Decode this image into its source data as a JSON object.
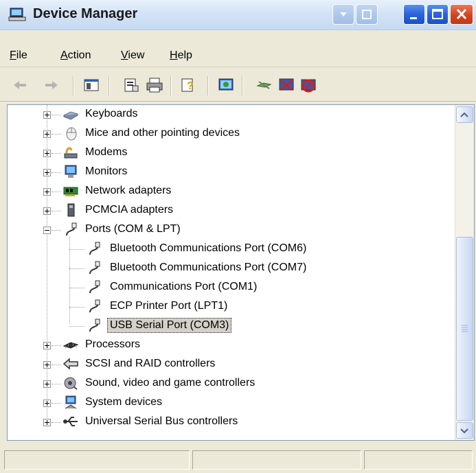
{
  "window": {
    "title": "Device Manager"
  },
  "menu": [
    {
      "label": "File"
    },
    {
      "label": "Action"
    },
    {
      "label": "View"
    },
    {
      "label": "Help"
    }
  ],
  "toolbar": {
    "icons": [
      "back-arrow-icon",
      "forward-arrow-icon",
      "show-hide-console-tree-icon",
      "properties-icon",
      "print-icon",
      "help-icon",
      "scan-hardware-icon",
      "update-driver-icon",
      "uninstall-icon",
      "disable-icon"
    ]
  },
  "tree": {
    "categories_top": [
      {
        "label": "Keyboards",
        "icon": "keyboard-icon"
      },
      {
        "label": "Mice and other pointing devices",
        "icon": "mouse-icon"
      },
      {
        "label": "Modems",
        "icon": "modem-icon"
      },
      {
        "label": "Monitors",
        "icon": "monitor-icon"
      },
      {
        "label": "Network adapters",
        "icon": "network-adapter-icon"
      },
      {
        "label": "PCMCIA adapters",
        "icon": "pcmcia-icon"
      }
    ],
    "ports": {
      "label": "Ports (COM & LPT)",
      "icon": "port-connector-icon",
      "children": [
        {
          "label": "Bluetooth Communications Port (COM6)"
        },
        {
          "label": "Bluetooth Communications Port (COM7)"
        },
        {
          "label": "Communications Port (COM1)"
        },
        {
          "label": "ECP Printer Port (LPT1)"
        },
        {
          "label": "USB Serial Port (COM3)",
          "selected": true
        }
      ]
    },
    "categories_bottom": [
      {
        "label": "Processors",
        "icon": "processor-icon"
      },
      {
        "label": "SCSI and RAID controllers",
        "icon": "scsi-icon"
      },
      {
        "label": "Sound, video and game controllers",
        "icon": "sound-icon"
      },
      {
        "label": "System devices",
        "icon": "system-devices-icon"
      },
      {
        "label": "Universal Serial Bus controllers",
        "icon": "usb-icon"
      }
    ]
  },
  "colors": {
    "selection": "#d4d0c8",
    "window_bg": "#ece9d8",
    "close_red": "#cf4421"
  }
}
